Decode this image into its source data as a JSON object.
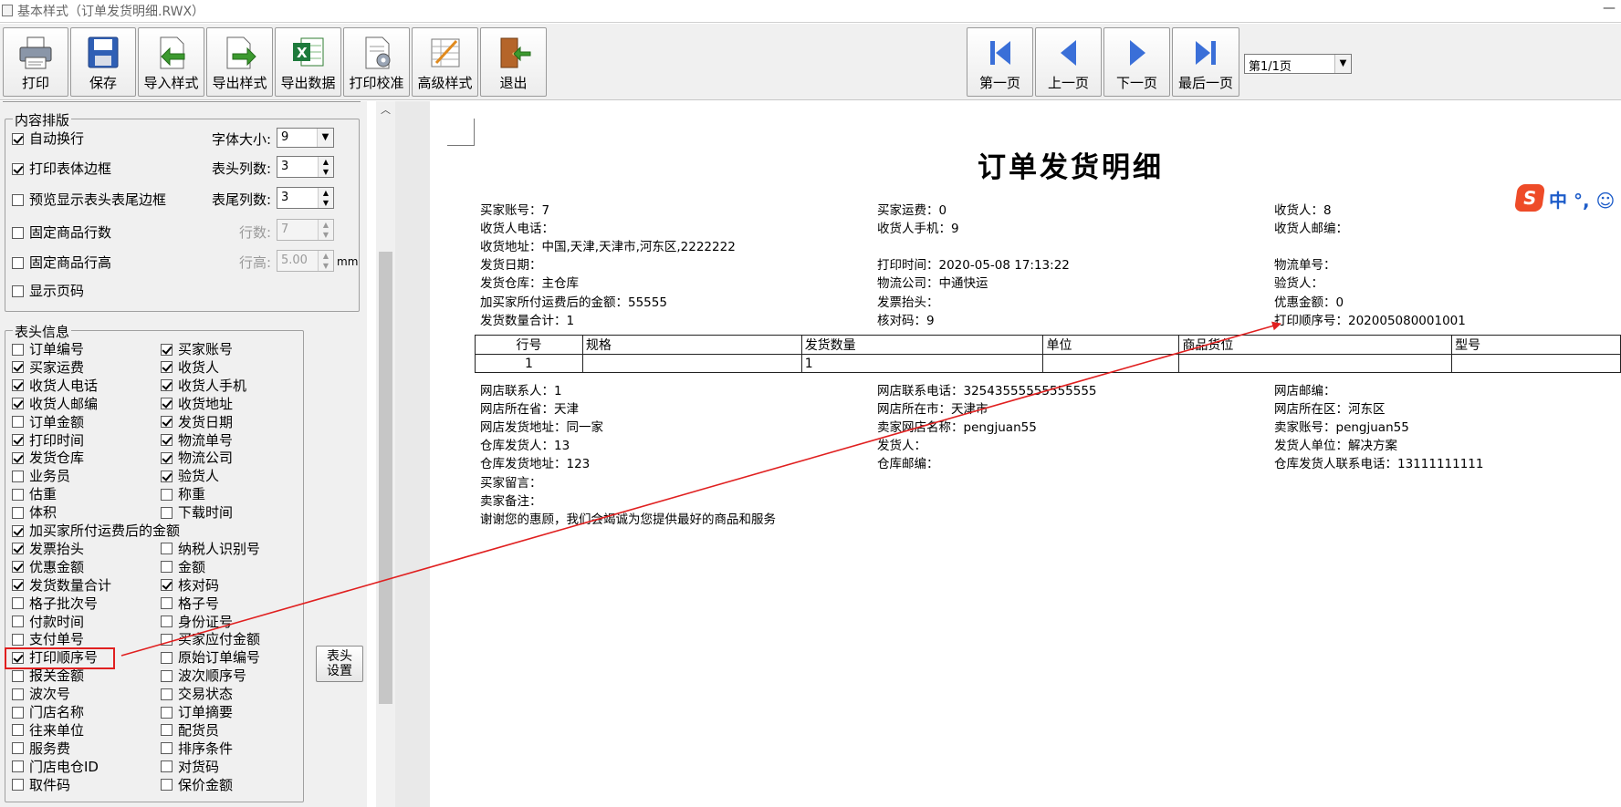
{
  "window": {
    "title": "基本样式（订单发货明细.RWX）",
    "minimize": "—"
  },
  "toolbar": {
    "print": "打印",
    "save": "保存",
    "import_style": "导入样式",
    "export_style": "导出样式",
    "export_data": "导出数据",
    "print_calibrate": "打印校准",
    "advanced_style": "高级样式",
    "exit": "退出",
    "first_page": "第一页",
    "prev_page": "上一页",
    "next_page": "下一页",
    "last_page": "最后一页",
    "page_select": "第1/1页"
  },
  "layout_group": {
    "legend": "内容排版",
    "auto_wrap": {
      "label": "自动换行",
      "checked": true
    },
    "print_table_border": {
      "label": "打印表体边框",
      "checked": true
    },
    "preview_header_footer_border": {
      "label": "预览显示表头表尾边框",
      "checked": false
    },
    "fixed_row_count": {
      "label": "固定商品行数",
      "checked": false
    },
    "fixed_row_height": {
      "label": "固定商品行高",
      "checked": false
    },
    "show_page_number": {
      "label": "显示页码",
      "checked": false
    },
    "font_size_label": "字体大小:",
    "font_size": "9",
    "header_cols_label": "表头列数:",
    "header_cols": "3",
    "footer_cols_label": "表尾列数:",
    "footer_cols": "3",
    "rows_label": "行数:",
    "rows": "7",
    "row_height_label": "行高:",
    "row_height": "5.00",
    "row_height_unit": "mm"
  },
  "header_info": {
    "legend": "表头信息",
    "settings_button": "表头\n设置",
    "items": [
      {
        "label": "订单编号",
        "checked": false
      },
      {
        "label": "买家账号",
        "checked": true
      },
      {
        "label": "买家运费",
        "checked": true
      },
      {
        "label": "收货人",
        "checked": true
      },
      {
        "label": "收货人电话",
        "checked": true
      },
      {
        "label": "收货人手机",
        "checked": true
      },
      {
        "label": "收货人邮编",
        "checked": true
      },
      {
        "label": "收货地址",
        "checked": true
      },
      {
        "label": "订单金额",
        "checked": false
      },
      {
        "label": "发货日期",
        "checked": true
      },
      {
        "label": "打印时间",
        "checked": true
      },
      {
        "label": "物流单号",
        "checked": true
      },
      {
        "label": "发货仓库",
        "checked": true
      },
      {
        "label": "物流公司",
        "checked": true
      },
      {
        "label": "业务员",
        "checked": false
      },
      {
        "label": "验货人",
        "checked": true
      },
      {
        "label": "估重",
        "checked": false
      },
      {
        "label": "称重",
        "checked": false
      },
      {
        "label": "体积",
        "checked": false
      },
      {
        "label": "下载时间",
        "checked": false
      },
      {
        "label": "加买家所付运费后的金额",
        "checked": true
      },
      null,
      {
        "label": "发票抬头",
        "checked": true
      },
      {
        "label": "纳税人识别号",
        "checked": false
      },
      {
        "label": "优惠金额",
        "checked": true
      },
      {
        "label": "金额",
        "checked": false
      },
      {
        "label": "发货数量合计",
        "checked": true
      },
      {
        "label": "核对码",
        "checked": true
      },
      {
        "label": "格子批次号",
        "checked": false
      },
      {
        "label": "格子号",
        "checked": false
      },
      {
        "label": "付款时间",
        "checked": false
      },
      {
        "label": "身份证号",
        "checked": false
      },
      {
        "label": "支付单号",
        "checked": false
      },
      {
        "label": "买家应付金额",
        "checked": false
      },
      {
        "label": "打印顺序号",
        "checked": true
      },
      {
        "label": "原始订单编号",
        "checked": false
      },
      {
        "label": "报关金额",
        "checked": false
      },
      {
        "label": "波次顺序号",
        "checked": false
      },
      {
        "label": "波次号",
        "checked": false
      },
      {
        "label": "交易状态",
        "checked": false
      },
      {
        "label": "门店名称",
        "checked": false
      },
      {
        "label": "订单摘要",
        "checked": false
      },
      {
        "label": "往来单位",
        "checked": false
      },
      {
        "label": "配货员",
        "checked": false
      },
      {
        "label": "服务费",
        "checked": false
      },
      {
        "label": "排序条件",
        "checked": false
      },
      {
        "label": "门店电仓ID",
        "checked": false
      },
      {
        "label": "对货码",
        "checked": false
      },
      {
        "label": "取件码",
        "checked": false
      },
      {
        "label": "保价金额",
        "checked": false
      }
    ]
  },
  "preview": {
    "title": "订单发货明细",
    "header_fields": [
      [
        "买家账号：7",
        "买家运费：0",
        "收货人：8"
      ],
      [
        "收货人电话：",
        "收货人手机：9",
        "收货人邮编："
      ],
      [
        "收货地址：中国,天津,天津市,河东区,2222222",
        "",
        ""
      ],
      [
        "发货日期：",
        "打印时间：2020-05-08 17:13:22",
        "物流单号："
      ],
      [
        "发货仓库：主仓库",
        "物流公司：中通快运",
        "验货人："
      ],
      [
        "加买家所付运费后的金额：55555",
        "发票抬头：",
        "优惠金额：0"
      ],
      [
        "发货数量合计：1",
        "核对码：9",
        "打印顺序号：202005080001001"
      ]
    ],
    "table": {
      "columns": [
        "行号",
        "规格",
        "发货数量",
        "单位",
        "商品货位",
        "型号"
      ],
      "rows": [
        [
          "1",
          "",
          "1",
          "",
          "",
          ""
        ]
      ]
    },
    "footer_fields": [
      [
        "网店联系人：1",
        "网店联系电话：32543555555555555",
        "网店邮编："
      ],
      [
        "网店所在省：天津",
        "网店所在市：天津市",
        "网店所在区：河东区"
      ],
      [
        "网店发货地址：同一家",
        "卖家网店名称：pengjuan55",
        "卖家账号：pengjuan55"
      ],
      [
        "仓库发货人：13",
        "发货人：",
        "发货人单位：解决方案"
      ],
      [
        "仓库发货地址：123",
        "仓库邮编：",
        "仓库发货人联系电话：13111111111"
      ],
      [
        "买家留言：",
        "",
        ""
      ],
      [
        "卖家备注：",
        "",
        ""
      ],
      [
        "谢谢您的惠顾，我们会竭诚为您提供最好的商品和服务",
        "",
        ""
      ]
    ]
  },
  "ime": {
    "logo": "S",
    "text": "中 °, ☺"
  },
  "icons": [
    "printer-icon",
    "floppy-disk-icon",
    "import-style-icon",
    "export-style-icon",
    "excel-export-icon",
    "print-calibrate-icon",
    "advanced-style-icon",
    "exit-door-icon",
    "first-page-icon",
    "prev-page-icon",
    "next-page-icon",
    "last-page-icon"
  ],
  "colors": {
    "annotation": "#e02020",
    "nav_arrow": "#3a6fd8",
    "window_bg": "#f0f0f0"
  }
}
